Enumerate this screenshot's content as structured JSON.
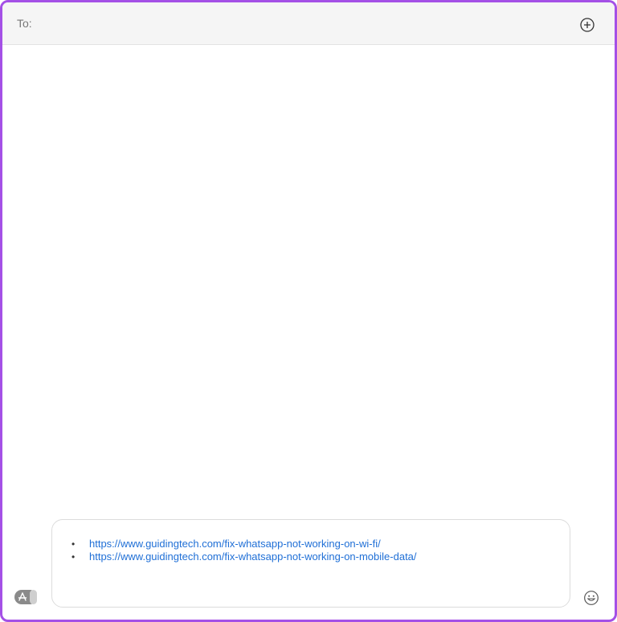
{
  "header": {
    "to_label": "To:",
    "add_icon": "plus-circle-icon"
  },
  "compose": {
    "links": [
      "https://www.guidingtech.com/fix-whatsapp-not-working-on-wi-fi/",
      "https://www.guidingtech.com/fix-whatsapp-not-working-on-mobile-data/"
    ],
    "bullet": "•"
  },
  "footer": {
    "apps_icon": "app-store-icon",
    "emoji_icon": "emoji-icon"
  },
  "colors": {
    "frame_border": "#a450e6",
    "link": "#1f6fd6",
    "header_bg": "#f5f5f5"
  }
}
